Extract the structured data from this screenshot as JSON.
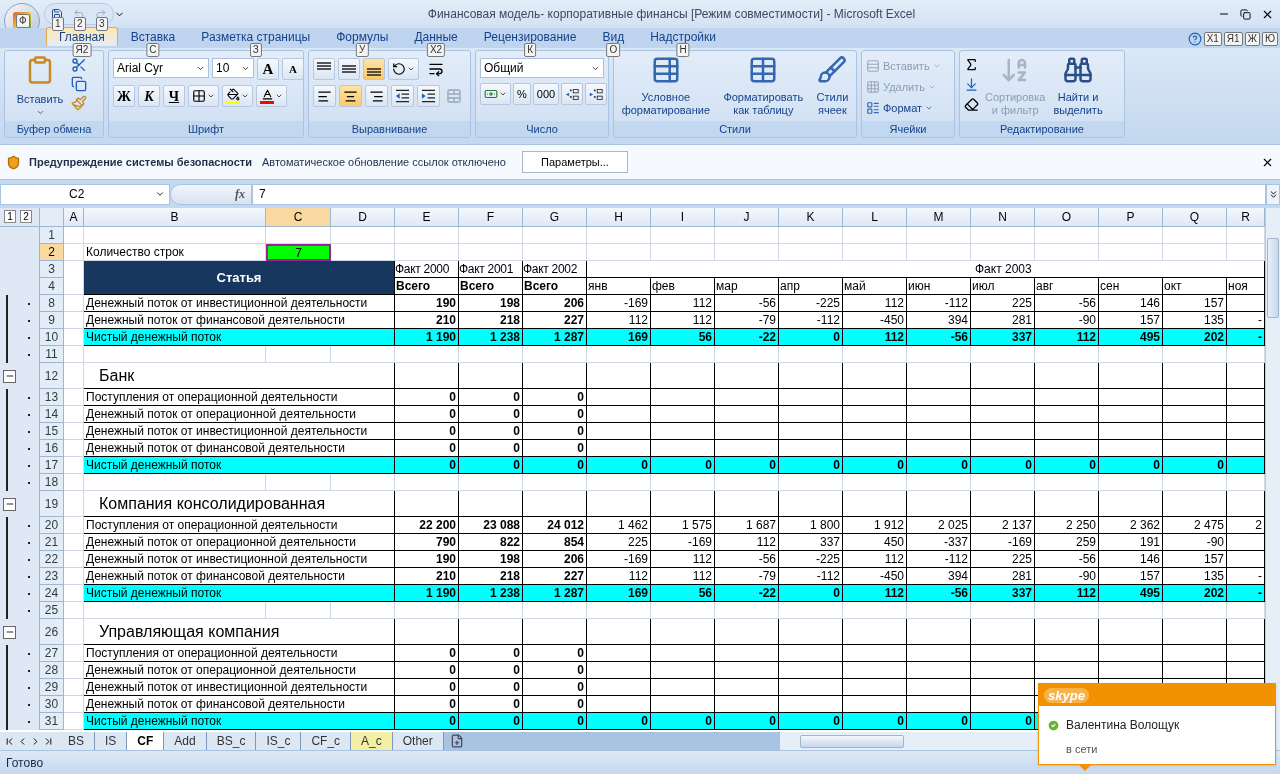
{
  "window": {
    "title": "Финансовая модель- корпоративные финансы  [Режим совместимости] - Microsoft Excel",
    "office_keytip": "Ф",
    "quick_access": [
      {
        "keytip": "1",
        "disabled": false
      },
      {
        "keytip": "2",
        "disabled": true
      },
      {
        "keytip": "3",
        "disabled": true
      }
    ]
  },
  "tabs": [
    {
      "label": "Главная",
      "keytip": "Я2",
      "selected": true
    },
    {
      "label": "Вставка",
      "keytip": "С",
      "selected": false
    },
    {
      "label": "Разметка страницы",
      "keytip": "З",
      "selected": false
    },
    {
      "label": "Формулы",
      "keytip": "У",
      "selected": false
    },
    {
      "label": "Данные",
      "keytip": "Х2",
      "selected": false
    },
    {
      "label": "Рецензирование",
      "keytip": "К",
      "selected": false
    },
    {
      "label": "Вид",
      "keytip": "О",
      "selected": false
    },
    {
      "label": "Надстройки",
      "keytip": "Н",
      "selected": false
    }
  ],
  "help_keytips": [
    "Х1",
    "Я1",
    "Ж",
    "Ю"
  ],
  "ribbon": {
    "clipboard": {
      "title": "Буфер обмена",
      "paste": "Вставить"
    },
    "font": {
      "title": "Шрифт",
      "name": "Arial Cyr",
      "size": "10",
      "grow": "A",
      "shrink": "A",
      "styles": [
        "Ж",
        "К",
        "Ч"
      ]
    },
    "alignment": {
      "title": "Выравнивание"
    },
    "number": {
      "title": "Число",
      "format": "Общий",
      "buttons": [
        "%",
        "000"
      ]
    },
    "styles": {
      "title": "Стили",
      "buttons": [
        "Условное\nформатирование",
        "Форматировать\nкак таблицу",
        "Стили\nячеек"
      ]
    },
    "cells": {
      "title": "Ячейки",
      "buttons": [
        {
          "label": "Вставить",
          "disabled": true
        },
        {
          "label": "Удалить",
          "disabled": true
        },
        {
          "label": "Формат",
          "disabled": false
        }
      ]
    },
    "editing": {
      "title": "Редактирование",
      "buttons": [
        {
          "label": "Сортировка\nи фильтр",
          "disabled": true
        },
        {
          "label": "Найти и\nвыделить",
          "disabled": false
        }
      ]
    }
  },
  "security_bar": {
    "title": "Предупреждение системы безопасности",
    "message": "Автоматическое обновление ссылок отключено",
    "button": "Параметры..."
  },
  "formula_bar": {
    "name_box": "C2",
    "fx": "fx",
    "value": "7"
  },
  "outline_levels": [
    "1",
    "2"
  ],
  "columns": [
    {
      "letter": "A",
      "selected": false
    },
    {
      "letter": "B",
      "selected": false
    },
    {
      "letter": "C",
      "selected": true
    },
    {
      "letter": "D",
      "selected": false
    },
    {
      "letter": "E",
      "selected": false
    },
    {
      "letter": "F",
      "selected": false
    },
    {
      "letter": "G",
      "selected": false
    },
    {
      "letter": "H",
      "selected": false
    },
    {
      "letter": "I",
      "selected": false
    },
    {
      "letter": "J",
      "selected": false
    },
    {
      "letter": "K",
      "selected": false
    },
    {
      "letter": "L",
      "selected": false
    },
    {
      "letter": "M",
      "selected": false
    },
    {
      "letter": "N",
      "selected": false
    },
    {
      "letter": "O",
      "selected": false
    },
    {
      "letter": "P",
      "selected": false
    },
    {
      "letter": "Q",
      "selected": false
    },
    {
      "letter": "R",
      "selected": false
    }
  ],
  "header": {
    "rows": [
      {
        "number": "3",
        "selected": false
      },
      {
        "number": "4",
        "selected": false
      }
    ],
    "title": "Статья",
    "years": [
      "Факт 2000",
      "Факт 2001",
      "Факт 2002"
    ],
    "year_span": "Факт 2003",
    "totals": [
      "Всего",
      "Всего",
      "Всего"
    ],
    "months": [
      "янв",
      "фев",
      "мар",
      "апр",
      "май",
      "июн",
      "июл",
      "авг",
      "сен",
      "окт",
      "ноя"
    ]
  },
  "rows_before": [
    {
      "number": "1",
      "selected": false,
      "kind": "blank"
    },
    {
      "number": "2",
      "selected": true,
      "kind": "param",
      "label": "Количество строк",
      "value": "7"
    }
  ],
  "rows": [
    {
      "number": "8",
      "selected": false,
      "kind": "data",
      "grouped": true,
      "label": "Денежный поток от инвестиционной деятельности",
      "values": [
        "190",
        "198",
        "206",
        "-169",
        "112",
        "-56",
        "-225",
        "112",
        "-112",
        "225",
        "-56",
        "146",
        "157"
      ]
    },
    {
      "number": "9",
      "selected": false,
      "kind": "data",
      "grouped": true,
      "label": "Денежный поток от финансовой деятельности",
      "values": [
        "210",
        "218",
        "227",
        "112",
        "112",
        "-79",
        "-112",
        "-450",
        "394",
        "281",
        "-90",
        "157",
        "135",
        "-"
      ]
    },
    {
      "number": "10",
      "selected": false,
      "kind": "total",
      "grouped": true,
      "label": "Чистый денежный поток",
      "values": [
        "1 190",
        "1 238",
        "1 287",
        "169",
        "56",
        "-22",
        "0",
        "112",
        "-56",
        "337",
        "112",
        "495",
        "202",
        "-"
      ]
    },
    {
      "number": "11",
      "selected": false,
      "kind": "blank",
      "grouped": true
    },
    {
      "number": "12",
      "selected": false,
      "kind": "section",
      "expanded": true,
      "label": "Банк"
    },
    {
      "number": "13",
      "selected": false,
      "kind": "data",
      "grouped": true,
      "label": "Поступления от операционной деятельности",
      "values": [
        "0",
        "0",
        "0"
      ]
    },
    {
      "number": "14",
      "selected": false,
      "kind": "data",
      "grouped": true,
      "label": "Денежный поток от операционной деятельности",
      "values": [
        "0",
        "0",
        "0"
      ]
    },
    {
      "number": "15",
      "selected": false,
      "kind": "data",
      "grouped": true,
      "label": "Денежный поток от инвестиционной деятельности",
      "values": [
        "0",
        "0",
        "0"
      ]
    },
    {
      "number": "16",
      "selected": false,
      "kind": "data",
      "grouped": true,
      "label": "Денежный поток от финансовой деятельности",
      "values": [
        "0",
        "0",
        "0"
      ]
    },
    {
      "number": "17",
      "selected": false,
      "kind": "total",
      "grouped": true,
      "label": "Чистый денежный поток",
      "values": [
        "0",
        "0",
        "0",
        "0",
        "0",
        "0",
        "0",
        "0",
        "0",
        "0",
        "0",
        "0",
        "0"
      ]
    },
    {
      "number": "18",
      "selected": false,
      "kind": "blank",
      "grouped": true
    },
    {
      "number": "19",
      "selected": false,
      "kind": "section",
      "expanded": true,
      "label": "Компания консолидированная"
    },
    {
      "number": "20",
      "selected": false,
      "kind": "data",
      "grouped": true,
      "label": "Поступления от операционной деятельности",
      "values": [
        "22 200",
        "23 088",
        "24 012",
        "1 462",
        "1 575",
        "1 687",
        "1 800",
        "1 912",
        "2 025",
        "2 137",
        "2 250",
        "2 362",
        "2 475",
        "2"
      ]
    },
    {
      "number": "21",
      "selected": false,
      "kind": "data",
      "grouped": true,
      "label": "Денежный поток от операционной деятельности",
      "values": [
        "790",
        "822",
        "854",
        "225",
        "-169",
        "112",
        "337",
        "450",
        "-337",
        "-169",
        "259",
        "191",
        "-90"
      ]
    },
    {
      "number": "22",
      "selected": false,
      "kind": "data",
      "grouped": true,
      "label": "Денежный поток от инвестиционной деятельности",
      "values": [
        "190",
        "198",
        "206",
        "-169",
        "112",
        "-56",
        "-225",
        "112",
        "-112",
        "225",
        "-56",
        "146",
        "157"
      ]
    },
    {
      "number": "23",
      "selected": false,
      "kind": "data",
      "grouped": true,
      "label": "Денежный поток от финансовой деятельности",
      "values": [
        "210",
        "218",
        "227",
        "112",
        "112",
        "-79",
        "-112",
        "-450",
        "394",
        "281",
        "-90",
        "157",
        "135",
        "-"
      ]
    },
    {
      "number": "24",
      "selected": false,
      "kind": "total",
      "grouped": true,
      "label": "Чистый денежный поток",
      "values": [
        "1 190",
        "1 238",
        "1 287",
        "169",
        "56",
        "-22",
        "0",
        "112",
        "-56",
        "337",
        "112",
        "495",
        "202",
        "-"
      ]
    },
    {
      "number": "25",
      "selected": false,
      "kind": "blank",
      "grouped": true
    },
    {
      "number": "26",
      "selected": false,
      "kind": "section",
      "expanded": true,
      "label": "Управляющая компания"
    },
    {
      "number": "27",
      "selected": false,
      "kind": "data",
      "grouped": true,
      "label": "Поступления от операционной деятельности",
      "values": [
        "0",
        "0",
        "0"
      ]
    },
    {
      "number": "28",
      "selected": false,
      "kind": "data",
      "grouped": true,
      "label": "Денежный поток от операционной деятельности",
      "values": [
        "0",
        "0",
        "0"
      ]
    },
    {
      "number": "29",
      "selected": false,
      "kind": "data",
      "grouped": true,
      "label": "Денежный поток от инвестиционной деятельности",
      "values": [
        "0",
        "0",
        "0"
      ]
    },
    {
      "number": "30",
      "selected": false,
      "kind": "data",
      "grouped": true,
      "label": "Денежный поток от финансовой деятельности",
      "values": [
        "0",
        "0",
        "0"
      ]
    },
    {
      "number": "31",
      "selected": false,
      "kind": "total",
      "grouped": true,
      "label": "Чистый денежный поток",
      "values": [
        "0",
        "0",
        "0",
        "0",
        "0",
        "0",
        "0",
        "0",
        "0",
        "0"
      ]
    }
  ],
  "sheet_tabs": [
    {
      "label": "BS",
      "selected": false
    },
    {
      "label": "IS",
      "selected": false
    },
    {
      "label": "CF",
      "selected": true
    },
    {
      "label": "Add",
      "selected": false
    },
    {
      "label": "BS_c",
      "selected": false
    },
    {
      "label": "IS_c",
      "selected": false
    },
    {
      "label": "CF_c",
      "selected": false
    },
    {
      "label": "A_c",
      "selected": false,
      "color": "#f3efa4"
    },
    {
      "label": "Other",
      "selected": false
    }
  ],
  "status": "Готово",
  "notification": {
    "app": "skype",
    "name": "Валентина Волощук",
    "status": "в сети",
    "online": true
  }
}
